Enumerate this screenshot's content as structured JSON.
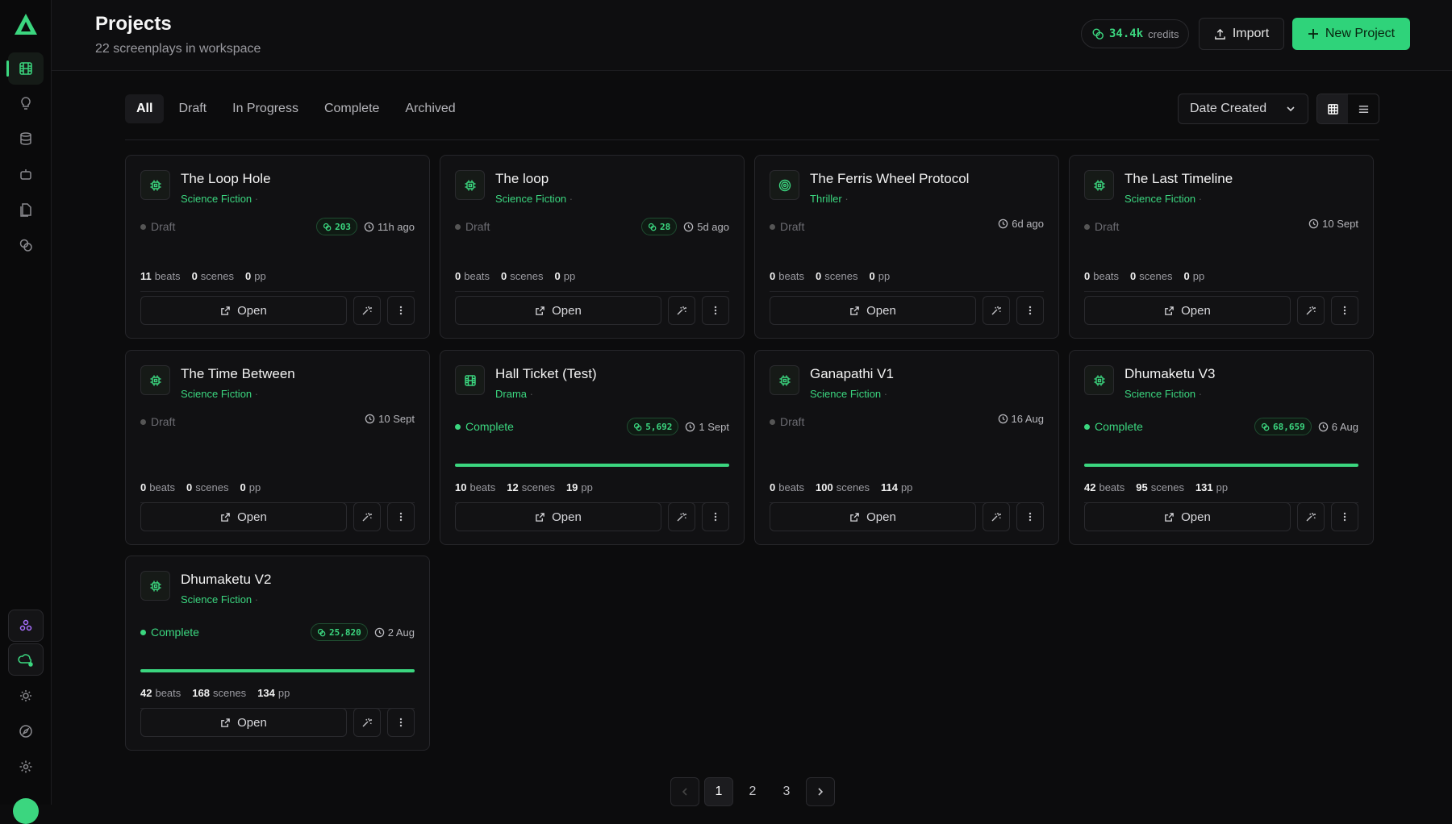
{
  "header": {
    "title": "Projects",
    "subtitle": "22 screenplays in workspace",
    "credits_value": "34.4k",
    "credits_label": "credits",
    "import_label": "Import",
    "new_project_label": "New Project"
  },
  "filters": [
    "All",
    "Draft",
    "In Progress",
    "Complete",
    "Archived"
  ],
  "sort": {
    "selected": "Date Created"
  },
  "accent": "#3bd67f",
  "projects": [
    {
      "title": "The Loop Hole",
      "genre": "Science Fiction",
      "status": "Draft",
      "tokens": "203",
      "time": "11h ago",
      "beats": "11",
      "scenes": "0",
      "pp": "0",
      "icon": "cpu-icon",
      "progress": 0
    },
    {
      "title": "The loop",
      "genre": "Science Fiction",
      "status": "Draft",
      "tokens": "28",
      "time": "5d ago",
      "beats": "0",
      "scenes": "0",
      "pp": "0",
      "icon": "cpu-icon",
      "progress": 0
    },
    {
      "title": "The Ferris Wheel Protocol",
      "genre": "Thriller",
      "status": "Draft",
      "tokens": "",
      "time": "6d ago",
      "beats": "0",
      "scenes": "0",
      "pp": "0",
      "icon": "target-icon",
      "progress": 0
    },
    {
      "title": "The Last Timeline",
      "genre": "Science Fiction",
      "status": "Draft",
      "tokens": "",
      "time": "10 Sept",
      "beats": "0",
      "scenes": "0",
      "pp": "0",
      "icon": "cpu-icon",
      "progress": 0
    },
    {
      "title": "The Time Between",
      "genre": "Science Fiction",
      "status": "Draft",
      "tokens": "",
      "time": "10 Sept",
      "beats": "0",
      "scenes": "0",
      "pp": "0",
      "icon": "cpu-icon",
      "progress": 0
    },
    {
      "title": "Hall Ticket (Test)",
      "genre": "Drama",
      "status": "Complete",
      "tokens": "5,692",
      "time": "1 Sept",
      "beats": "10",
      "scenes": "12",
      "pp": "19",
      "icon": "film-icon",
      "progress": 1
    },
    {
      "title": "Ganapathi V1",
      "genre": "Science Fiction",
      "status": "Draft",
      "tokens": "",
      "time": "16 Aug",
      "beats": "0",
      "scenes": "100",
      "pp": "114",
      "icon": "cpu-icon",
      "progress": 0
    },
    {
      "title": "Dhumaketu V3",
      "genre": "Science Fiction",
      "status": "Complete",
      "tokens": "68,659",
      "time": "6 Aug",
      "beats": "42",
      "scenes": "95",
      "pp": "131",
      "icon": "cpu-icon",
      "progress": 1
    },
    {
      "title": "Dhumaketu V2",
      "genre": "Science Fiction",
      "status": "Complete",
      "tokens": "25,820",
      "time": "2 Aug",
      "beats": "42",
      "scenes": "168",
      "pp": "134",
      "icon": "cpu-icon",
      "progress": 1
    }
  ],
  "labels": {
    "beats": "beats",
    "scenes": "scenes",
    "pp": "pp",
    "open": "Open",
    "genre_sep": "·"
  },
  "pagination": {
    "pages": [
      "1",
      "2",
      "3"
    ],
    "current": "1"
  }
}
